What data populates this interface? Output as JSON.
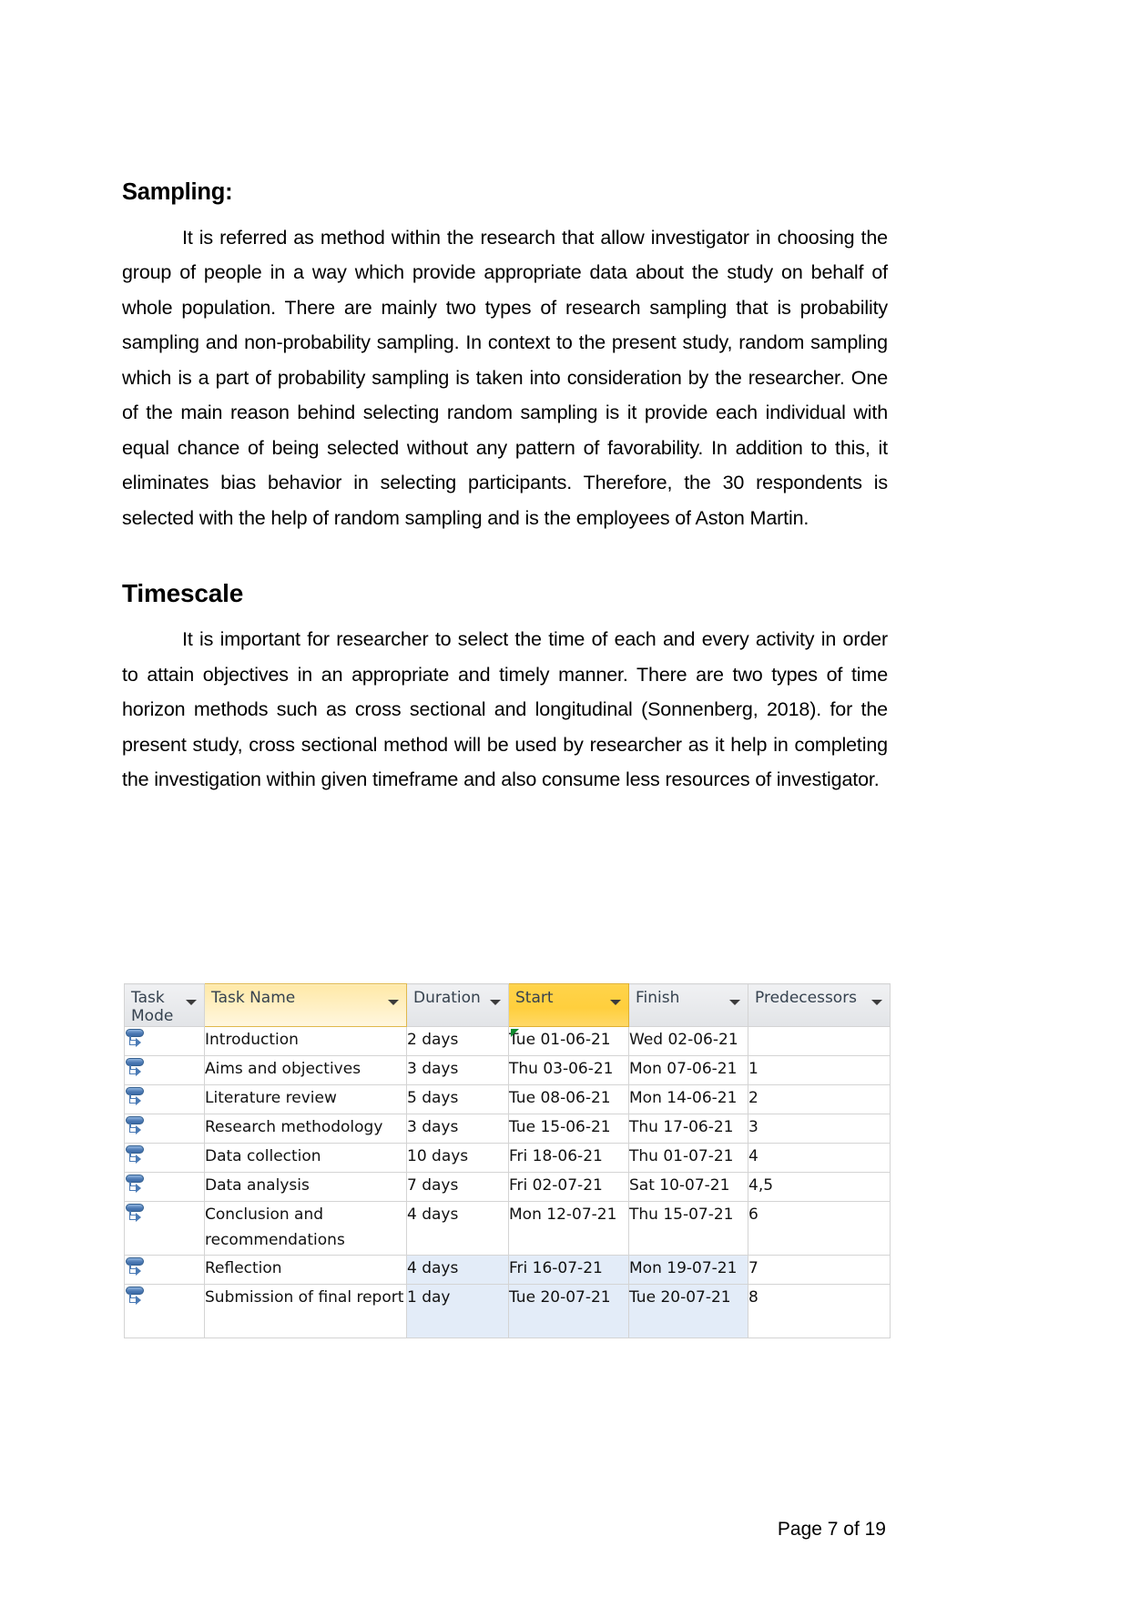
{
  "document": {
    "sections": [
      {
        "heading": "Sampling:",
        "paragraph": "It is referred as method within the research that allow investigator in choosing the group of people in a way which provide appropriate data about the study on behalf of whole population. There are mainly two types of research sampling that is probability sampling and non-probability sampling. In context to the present study, random sampling which is a part of probability sampling is taken into consideration by the researcher. One of the main reason behind selecting random sampling is it provide each individual with equal chance of being selected without any pattern of favorability. In addition to this, it eliminates bias behavior in selecting participants. Therefore, the 30 respondents is selected with the help of random sampling and is the employees of Aston Martin."
      },
      {
        "heading": "Timescale",
        "paragraph": "It is important for researcher to select the time of each and every activity in order to attain objectives in an appropriate and timely manner. There are two types of time horizon methods such as cross sectional and longitudinal (Sonnenberg, 2018). for the present study, cross sectional method will be used by researcher as it help in completing the investigation within given timeframe and also consume less resources of investigator."
      }
    ],
    "footer": "Page 7 of 19"
  },
  "gantt_table": {
    "columns": [
      {
        "key": "task_mode",
        "label": "Task Mode",
        "highlight": "none"
      },
      {
        "key": "task_name",
        "label": "Task Name",
        "highlight": "light-yellow"
      },
      {
        "key": "duration",
        "label": "Duration",
        "highlight": "none"
      },
      {
        "key": "start",
        "label": "Start",
        "highlight": "gold"
      },
      {
        "key": "finish",
        "label": "Finish",
        "highlight": "none"
      },
      {
        "key": "predecessors",
        "label": "Predecessors",
        "highlight": "none"
      }
    ],
    "colors": {
      "header_default": "#e2e4e7",
      "header_task_name": "#ffe9a8",
      "header_start": "#ffd34a",
      "selected_row": "#e3ecf8",
      "grid_line": "#dcdcdc",
      "flag_marker": "#0e8a2e",
      "mode_icon": "#4e7bb5"
    },
    "rows": [
      {
        "task_mode_icon": "manually-scheduled-icon",
        "task_name": "Introduction",
        "duration": "2 days",
        "start": "Tue 01-06-21",
        "finish": "Wed 02-06-21",
        "predecessors": "",
        "start_flag": true,
        "selected": false,
        "tall": false
      },
      {
        "task_mode_icon": "manually-scheduled-icon",
        "task_name": "Aims and objectives",
        "duration": "3 days",
        "start": "Thu 03-06-21",
        "finish": "Mon 07-06-21",
        "predecessors": "1",
        "start_flag": false,
        "selected": false,
        "tall": false
      },
      {
        "task_mode_icon": "manually-scheduled-icon",
        "task_name": "Literature review",
        "duration": "5 days",
        "start": "Tue 08-06-21",
        "finish": "Mon 14-06-21",
        "predecessors": "2",
        "start_flag": false,
        "selected": false,
        "tall": false
      },
      {
        "task_mode_icon": "manually-scheduled-icon",
        "task_name": "Research methodology",
        "duration": "3 days",
        "start": "Tue 15-06-21",
        "finish": "Thu 17-06-21",
        "predecessors": "3",
        "start_flag": false,
        "selected": false,
        "tall": false
      },
      {
        "task_mode_icon": "manually-scheduled-icon",
        "task_name": "Data collection",
        "duration": "10 days",
        "start": "Fri 18-06-21",
        "finish": "Thu 01-07-21",
        "predecessors": "4",
        "start_flag": false,
        "selected": false,
        "tall": false
      },
      {
        "task_mode_icon": "manually-scheduled-icon",
        "task_name": "Data analysis",
        "duration": "7 days",
        "start": "Fri 02-07-21",
        "finish": "Sat 10-07-21",
        "predecessors": "4,5",
        "start_flag": false,
        "selected": false,
        "tall": false
      },
      {
        "task_mode_icon": "manually-scheduled-icon",
        "task_name": "Conclusion and recommendations",
        "duration": "4 days",
        "start": "Mon 12-07-21",
        "finish": "Thu 15-07-21",
        "predecessors": "6",
        "start_flag": false,
        "selected": false,
        "tall": true
      },
      {
        "task_mode_icon": "manually-scheduled-icon",
        "task_name": "Reflection",
        "duration": "4 days",
        "start": "Fri 16-07-21",
        "finish": "Mon 19-07-21",
        "predecessors": "7",
        "start_flag": false,
        "selected": true,
        "tall": false
      },
      {
        "task_mode_icon": "manually-scheduled-icon",
        "task_name": "Submission of final report",
        "duration": "1 day",
        "start": "Tue 20-07-21",
        "finish": "Tue 20-07-21",
        "predecessors": "8",
        "start_flag": false,
        "selected": true,
        "tall": true
      }
    ]
  }
}
